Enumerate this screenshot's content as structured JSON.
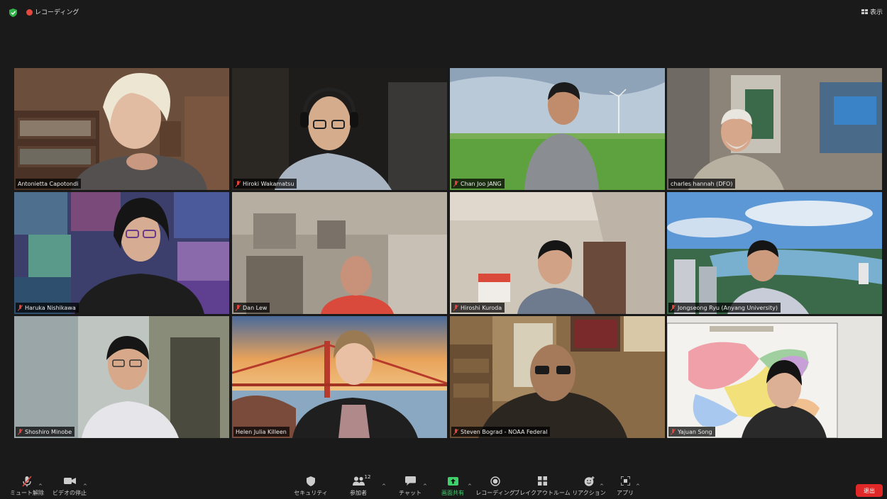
{
  "topbar": {
    "recording_label": "レコーディング",
    "view_label": "表示"
  },
  "participants": [
    {
      "name": "Antonietta Capotondi",
      "muted": false,
      "active": true
    },
    {
      "name": "Hiroki Wakamatsu",
      "muted": true,
      "active": false
    },
    {
      "name": "Chan Joo JANG",
      "muted": true,
      "active": false
    },
    {
      "name": "charles hannah (DFO)",
      "muted": false,
      "active": false
    },
    {
      "name": "Haruka Nishikawa",
      "muted": true,
      "active": false
    },
    {
      "name": "Dan Lew",
      "muted": true,
      "active": false
    },
    {
      "name": "Hiroshi Kuroda",
      "muted": true,
      "active": false
    },
    {
      "name": "Jongseong Ryu (Anyang University)",
      "muted": true,
      "active": false
    },
    {
      "name": "Shoshiro Minobe",
      "muted": true,
      "active": false
    },
    {
      "name": "Helen Julia Killeen",
      "muted": false,
      "active": false
    },
    {
      "name": "Steven Bograd - NOAA Federal",
      "muted": true,
      "active": false
    },
    {
      "name": "Yajuan Song",
      "muted": true,
      "active": false
    }
  ],
  "toolbar": {
    "unmute_label": "ミュート解除",
    "stop_video_label": "ビデオの停止",
    "security_label": "セキュリティ",
    "participants_label": "参加者",
    "participants_count": "12",
    "chat_label": "チャット",
    "share_screen_label": "画面共有",
    "record_label": "レコーディング",
    "breakout_label": "ブレイクアウトルーム",
    "reactions_label": "リアクション",
    "apps_label": "アプリ",
    "leave_label": "退出"
  },
  "colors": {
    "active_speaker_border": "#c9e14b",
    "share_green": "#3fd06c",
    "leave_red": "#e02828",
    "recording_red": "#e5483f",
    "mute_red": "#e0443a"
  }
}
